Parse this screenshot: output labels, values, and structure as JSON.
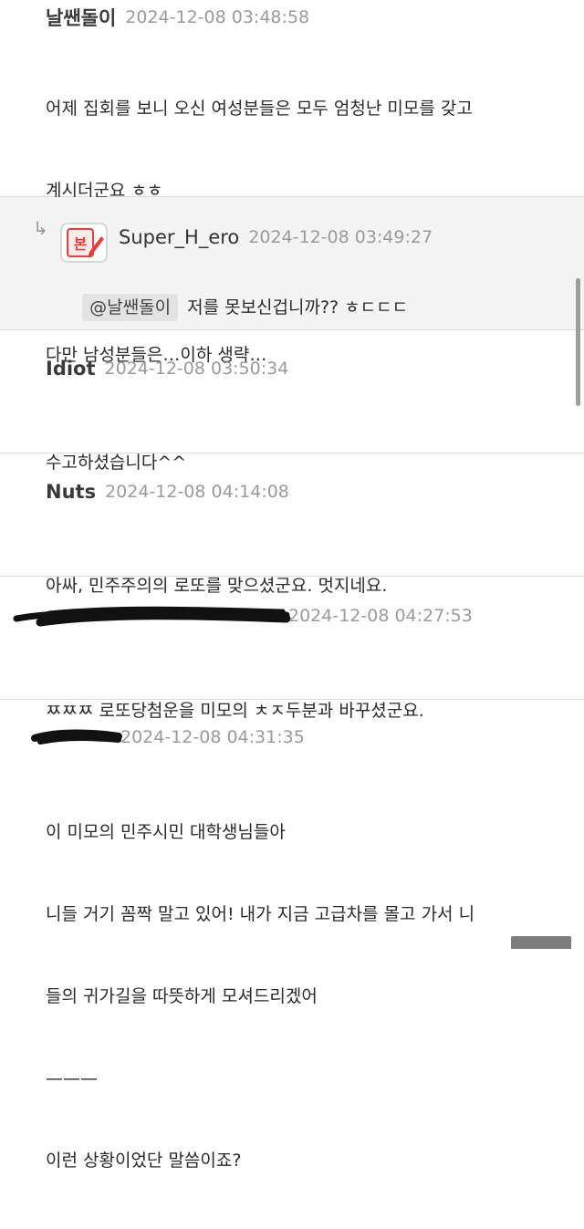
{
  "comments": [
    {
      "author": "날쌘돌이",
      "time": "2024-12-08 03:48:58",
      "lines": [
        "어제 집회를 보니 오신 여성분들은 모두 엄청난 미모를 갖고",
        "계시더군요 ㅎㅎ",
        "",
        "다만 남성분들은…이하 생략…"
      ]
    },
    {
      "author": "Super_H_ero",
      "time": "2024-12-08 03:49:27",
      "mention": "@날쌘돌이",
      "text": "저를 못보신겁니까?? ㅎㄷㄷㄷ",
      "is_reply": true,
      "avatar_label": "본"
    },
    {
      "author": "Idiot",
      "time": "2024-12-08 03:50:34",
      "lines": [
        "수고하셨습니다^^"
      ]
    },
    {
      "author": "Nuts",
      "time": "2024-12-08 04:14:08",
      "lines": [
        "아싸, 민주주의의 로또를 맞으셨군요. 멋지네요."
      ]
    },
    {
      "author": "",
      "time": "2024-12-08 04:27:53",
      "lines": [
        "ㅉㅉㅉ 로또당첨운을 미모의 ㅊㅈ두분과 바꾸셨군요."
      ],
      "author_redacted": true
    },
    {
      "author": "",
      "time": "2024-12-08 04:31:35",
      "lines": [
        "이 미모의 민주시민 대학생님들아",
        "니들 거기 꼼짝 말고 있어! 내가 지금 고급차를 몰고 가서 니",
        "들의 귀가길을 따뜻하게 모셔드리겠어",
        "———",
        "이런 상황이었단 말씀이죠?"
      ],
      "author_redacted": true
    }
  ],
  "icons": {
    "reply": "reply-arrow-icon",
    "avatar": "edit-document-icon"
  },
  "colors": {
    "avatar_red": "#e2423a",
    "reply_bg": "#f4f4f4",
    "divider": "#dcdcdc"
  }
}
